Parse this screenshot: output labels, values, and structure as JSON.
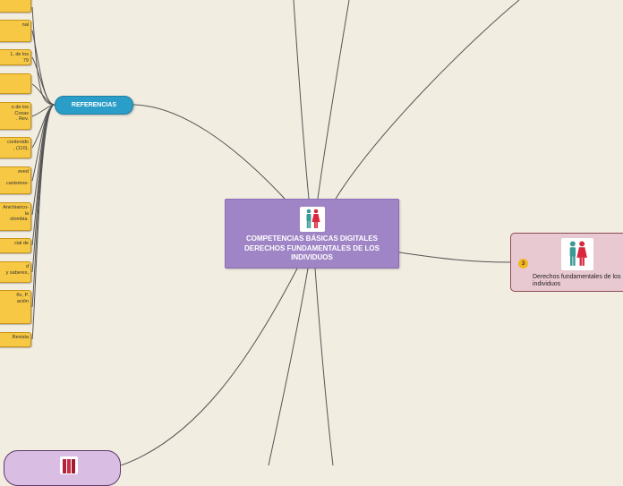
{
  "central": {
    "title": "COMPETENCIAS BÁSICAS DIGITALES DERECHOS FUNDAMENTALES DE LOS INDIVIDUOS",
    "icon": "man-woman-icon",
    "color": "#9f85c6"
  },
  "references": {
    "label": "REFERENCIAS",
    "color": "#2a9ec8",
    "notes": [
      "",
      "nal",
      "1, de los\n79",
      "",
      "o de los\nCosas\n. Rev.",
      "contenido\n, (110),",
      "eved\n\ncanismos-",
      "Anichiarico-\nla\nolombia.",
      "cial de",
      "d\ny saberes,",
      "ño, P.\nación",
      "Revista"
    ],
    "note_color": "#f7c843"
  },
  "right_node": {
    "badge": "3",
    "label": "Derechos fundamentales de los individuos",
    "icon": "man-woman-icon",
    "color": "#e9c9d1"
  },
  "bottom_node": {
    "icon": "books-icon",
    "color": "#d9bde3"
  }
}
